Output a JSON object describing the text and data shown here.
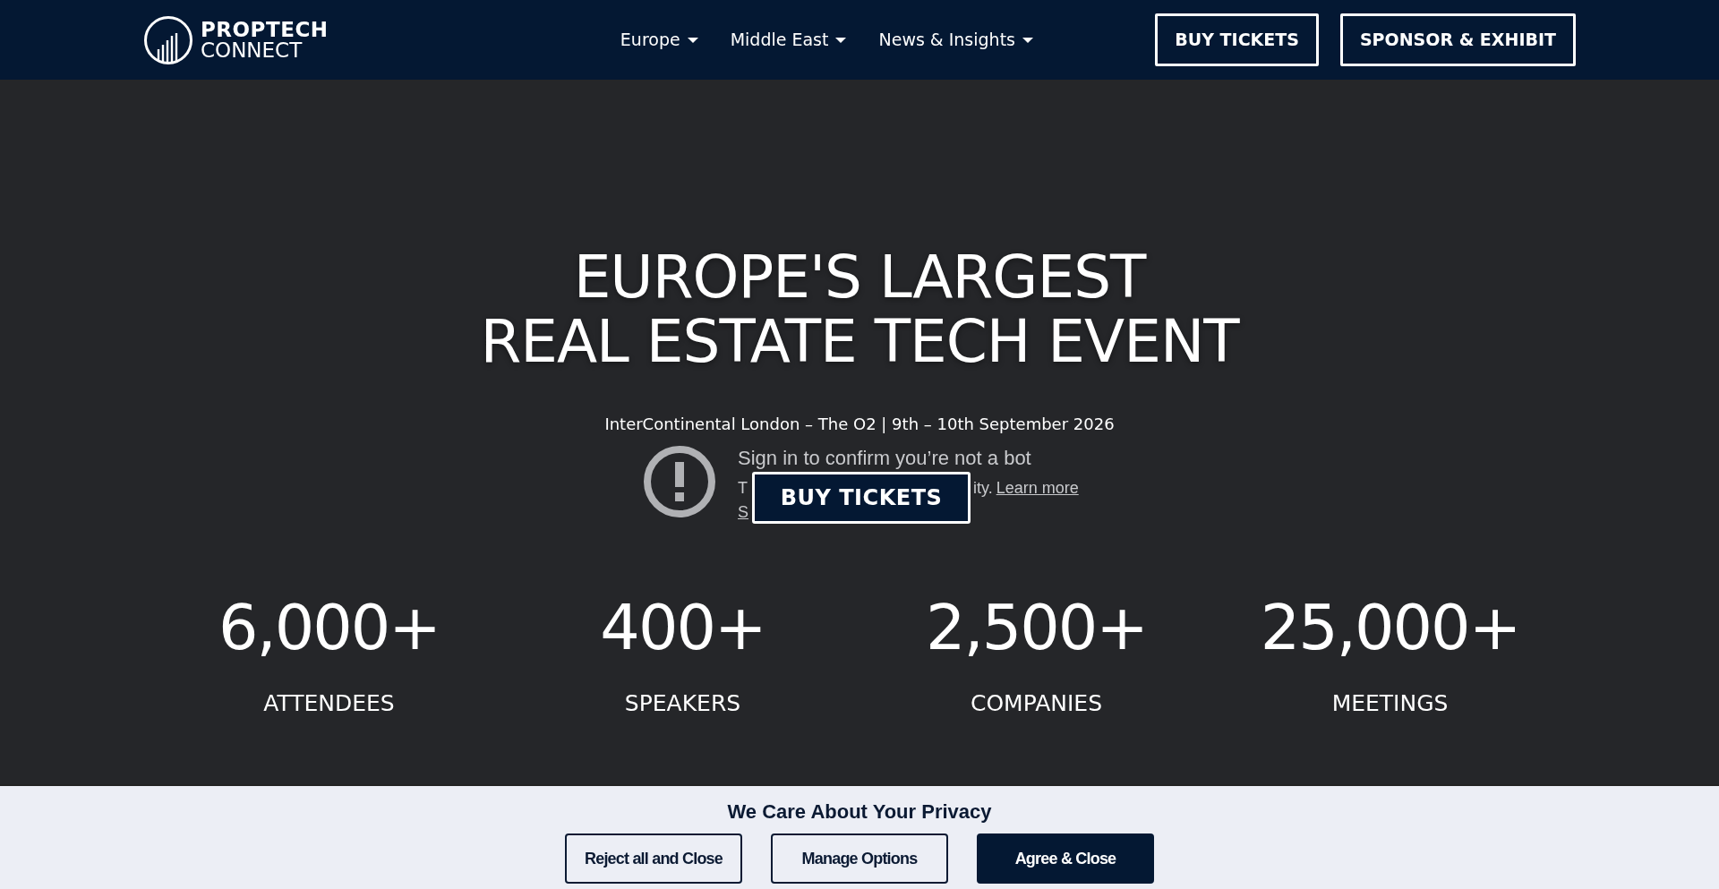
{
  "header": {
    "logo": {
      "line_1": "PROPTECH",
      "line_2": "CONNECT"
    },
    "nav": [
      {
        "label": "Europe",
        "has_dropdown": true
      },
      {
        "label": "Middle East",
        "has_dropdown": true
      },
      {
        "label": "News & Insights",
        "has_dropdown": true
      }
    ],
    "buttons": [
      "BUY TICKETS",
      "SPONSOR & EXHIBIT"
    ]
  },
  "hero": {
    "title_lines": [
      "EUROPE'S LARGEST",
      "REAL ESTATE TECH EVENT"
    ],
    "subtitle": "InterContinental London – The O2 | 9th – 10th September 2026",
    "bot_notice": {
      "heading": "Sign in to confirm you’re not a bot",
      "line_2_start": "T",
      "line_2_end": "ity.",
      "learn_more": "Learn more",
      "line_3_start": "S"
    },
    "cta": "BUY TICKETS",
    "stats": [
      {
        "value": "6,000+",
        "label": "ATTENDEES"
      },
      {
        "value": "400+",
        "label": "SPEAKERS"
      },
      {
        "value": "2,500+",
        "label": "COMPANIES"
      },
      {
        "value": "25,000+",
        "label": "MEETINGS"
      }
    ]
  },
  "privacy_banner": {
    "title": "We Care About Your Privacy",
    "buttons": [
      {
        "label": "Reject all and Close",
        "kind": "outline"
      },
      {
        "label": "Manage Options",
        "kind": "outline"
      },
      {
        "label": "Agree & Close",
        "kind": "solid"
      }
    ]
  }
}
